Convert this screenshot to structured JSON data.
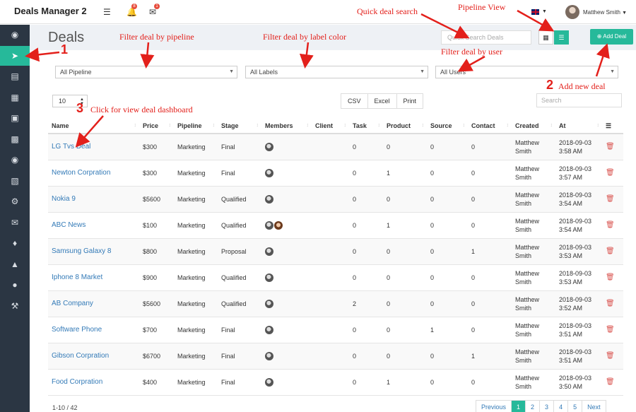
{
  "app": {
    "title": "Deals Manager 2"
  },
  "topbar": {
    "notif_count": "8",
    "mail_count": "1",
    "user_name": "Matthew Smith"
  },
  "page": {
    "title": "Deals"
  },
  "search": {
    "quick_placeholder": "Quick Search Deals",
    "table_placeholder": "Search"
  },
  "buttons": {
    "add_deal": "Add Deal"
  },
  "filters": {
    "pipeline": "All Pipeline",
    "labels": "All Labels",
    "users": "All Users"
  },
  "table_controls": {
    "page_size": "10",
    "csv": "CSV",
    "excel": "Excel",
    "print": "Print"
  },
  "columns": [
    "Name",
    "Price",
    "Pipeline",
    "Stage",
    "Members",
    "Client",
    "Task",
    "Product",
    "Source",
    "Contact",
    "Created",
    "At"
  ],
  "rows": [
    {
      "name": "LG Tvs Deal",
      "price": "$300",
      "pipeline": "Marketing",
      "stage": "Final",
      "members": 1,
      "client": "",
      "task": "0",
      "product": "0",
      "source": "0",
      "contact": "0",
      "created1": "Matthew",
      "created2": "Smith",
      "at1": "2018-09-03",
      "at2": "3:58 AM"
    },
    {
      "name": "Newton Corpration",
      "price": "$300",
      "pipeline": "Marketing",
      "stage": "Final",
      "members": 1,
      "client": "",
      "task": "0",
      "product": "1",
      "source": "0",
      "contact": "0",
      "created1": "Matthew",
      "created2": "Smith",
      "at1": "2018-09-03",
      "at2": "3:57 AM"
    },
    {
      "name": "Nokia 9",
      "price": "$5600",
      "pipeline": "Marketing",
      "stage": "Qualified",
      "members": 1,
      "client": "",
      "task": "0",
      "product": "0",
      "source": "0",
      "contact": "0",
      "created1": "Matthew",
      "created2": "Smith",
      "at1": "2018-09-03",
      "at2": "3:54 AM"
    },
    {
      "name": "ABC News",
      "price": "$100",
      "pipeline": "Marketing",
      "stage": "Qualified",
      "members": 2,
      "client": "",
      "task": "0",
      "product": "1",
      "source": "0",
      "contact": "0",
      "created1": "Matthew",
      "created2": "Smith",
      "at1": "2018-09-03",
      "at2": "3:54 AM"
    },
    {
      "name": "Samsung Galaxy 8",
      "price": "$800",
      "pipeline": "Marketing",
      "stage": "Proposal",
      "members": 1,
      "client": "",
      "task": "0",
      "product": "0",
      "source": "0",
      "contact": "1",
      "created1": "Matthew",
      "created2": "Smith",
      "at1": "2018-09-03",
      "at2": "3:53 AM"
    },
    {
      "name": "Iphone 8 Market",
      "price": "$900",
      "pipeline": "Marketing",
      "stage": "Qualified",
      "members": 1,
      "client": "",
      "task": "0",
      "product": "0",
      "source": "0",
      "contact": "0",
      "created1": "Matthew",
      "created2": "Smith",
      "at1": "2018-09-03",
      "at2": "3:53 AM"
    },
    {
      "name": "AB Company",
      "price": "$5600",
      "pipeline": "Marketing",
      "stage": "Qualified",
      "members": 1,
      "client": "",
      "task": "2",
      "product": "0",
      "source": "0",
      "contact": "0",
      "created1": "Matthew",
      "created2": "Smith",
      "at1": "2018-09-03",
      "at2": "3:52 AM"
    },
    {
      "name": "Software Phone",
      "price": "$700",
      "pipeline": "Marketing",
      "stage": "Final",
      "members": 1,
      "client": "",
      "task": "0",
      "product": "0",
      "source": "1",
      "contact": "0",
      "created1": "Matthew",
      "created2": "Smith",
      "at1": "2018-09-03",
      "at2": "3:51 AM"
    },
    {
      "name": "Gibson Corpration",
      "price": "$6700",
      "pipeline": "Marketing",
      "stage": "Final",
      "members": 1,
      "client": "",
      "task": "0",
      "product": "0",
      "source": "0",
      "contact": "1",
      "created1": "Matthew",
      "created2": "Smith",
      "at1": "2018-09-03",
      "at2": "3:51 AM"
    },
    {
      "name": "Food Corpration",
      "price": "$400",
      "pipeline": "Marketing",
      "stage": "Final",
      "members": 1,
      "client": "",
      "task": "0",
      "product": "1",
      "source": "0",
      "contact": "0",
      "created1": "Matthew",
      "created2": "Smith",
      "at1": "2018-09-03",
      "at2": "3:50 AM"
    }
  ],
  "footer": {
    "info": "1-10 / 42"
  },
  "pagination": {
    "previous": "Previous",
    "pages": [
      "1",
      "2",
      "3",
      "4",
      "5"
    ],
    "next": "Next",
    "current": "1"
  },
  "sidebar": {
    "items": [
      "dashboard-icon",
      "rocket-icon",
      "list-icon",
      "calendar-icon",
      "cart-icon",
      "building-icon",
      "users-icon",
      "chart-icon",
      "gear-icon",
      "envelope-icon",
      "tag-icon",
      "megaphone-icon",
      "user-icon",
      "wrench-icon"
    ],
    "active": "rocket-icon"
  },
  "annotations": {
    "quick_search": "Quick deal search",
    "pipeline_view": "Pipeline View",
    "filter_pipeline": "Filter deal by pipeline",
    "filter_label": "Filter deal by label color",
    "filter_user": "Filter deal by user",
    "add_new": "Add new deal",
    "dashboard": "Click for view deal dashboard",
    "num1": "1",
    "num2": "2",
    "num3": "3"
  },
  "colors": {
    "accent": "#26b99a",
    "sidebar": "#2b3643",
    "annotation": "#e3201b",
    "link": "#337ab7"
  }
}
